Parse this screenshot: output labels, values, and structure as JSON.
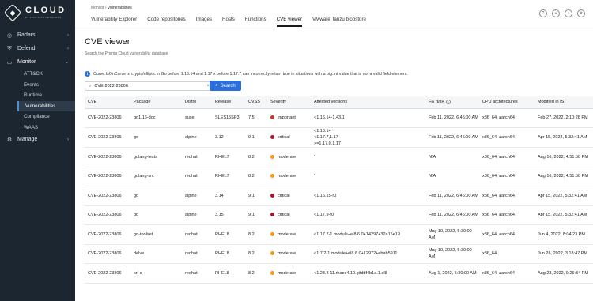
{
  "logo": {
    "title": "CLOUD",
    "subtitle": "BY PALO ALTO NETWORKS"
  },
  "sidebar": {
    "groups": [
      {
        "label": "Radars",
        "icon": "radar-icon"
      },
      {
        "label": "Defend",
        "icon": "shield-icon"
      },
      {
        "label": "Monitor",
        "icon": "monitor-icon"
      },
      {
        "label": "Manage",
        "icon": "gear-icon"
      }
    ],
    "monitor_items": [
      "ATT&CK",
      "Events",
      "Runtime",
      "Vulnerabilities",
      "Compliance",
      "WAAS"
    ]
  },
  "header": {
    "breadcrumb_parent": "Monitor",
    "breadcrumb_sep": " / ",
    "breadcrumb_current": "Vulnerabilities",
    "tabs": [
      "Vulnerability Explorer",
      "Code repositories",
      "Images",
      "Hosts",
      "Functions",
      "CVE viewer",
      "VMware Tanzu blobstore"
    ],
    "icons": [
      "help-icon",
      "user-icon",
      "bell-icon",
      "settings-icon"
    ]
  },
  "page": {
    "title": "CVE viewer",
    "subtitle": "Search the Prisma Cloud vulnerability database",
    "info_text": "Curve.IsOnCurve in crypto/elliptic in Go before 1.16.14 and 1.17.x before 1.17.7 can incorrectly return true in situations with a big.Int value that is not a valid field element.",
    "search_value": "CVE-2022-23806",
    "search_button": "Search"
  },
  "colors": {
    "critical": "#b3122e",
    "important": "#c0392b",
    "moderate": "#f39c12",
    "accent": "#2a6fdb",
    "sidebar": "#1c2631"
  },
  "table": {
    "columns": [
      "CVE",
      "Package",
      "Distro",
      "Release",
      "CVSS",
      "Severity",
      "Affected versions",
      "Fix date",
      "CPU architectures",
      "Modified in IS"
    ],
    "rows": [
      {
        "cve": "CVE-2022-23806",
        "package": "go1.16-doc",
        "distro": "suse",
        "release": "SLES15SP3",
        "cvss": "7.5",
        "severity": "important",
        "affected": "<1.16.14-1.43.1",
        "fix_date": "Feb 11, 2022, 6:45:00 AM",
        "cpu": "x86_64, aarch64",
        "modified": "Feb 27, 2022, 2:10:28 PM"
      },
      {
        "cve": "CVE-2022-23806",
        "package": "go",
        "distro": "alpine",
        "release": "3.12",
        "cvss": "9.1",
        "severity": "critical",
        "affected": "<1.16.14\n<1.17.7,1.17\n>=1.17.0,1.17",
        "fix_date": "Feb 11, 2022, 6:45:00 AM",
        "cpu": "x86_64, aarch64",
        "modified": "Apr 15, 2022, 5:32:41 AM"
      },
      {
        "cve": "CVE-2022-23806",
        "package": "golang-tests",
        "distro": "redhat",
        "release": "RHEL7",
        "cvss": "8.2",
        "severity": "moderate",
        "affected": "*",
        "fix_date": "N/A",
        "cpu": "x86_64, aarch64",
        "modified": "Aug 16, 2022, 4:51:58 PM"
      },
      {
        "cve": "CVE-2022-23806",
        "package": "golang-src",
        "distro": "redhat",
        "release": "RHEL7",
        "cvss": "8.2",
        "severity": "moderate",
        "affected": "*",
        "fix_date": "N/A",
        "cpu": "x86_64, aarch64",
        "modified": "Aug 16, 2022, 4:51:58 PM"
      },
      {
        "cve": "CVE-2022-23806",
        "package": "go",
        "distro": "alpine",
        "release": "3.14",
        "cvss": "9.1",
        "severity": "critical",
        "affected": "<1.16.15-r0",
        "fix_date": "Feb 11, 2022, 6:45:00 AM",
        "cpu": "x86_64, aarch64",
        "modified": "Apr 15, 2022, 5:32:41 AM"
      },
      {
        "cve": "CVE-2022-23806",
        "package": "go",
        "distro": "alpine",
        "release": "3.15",
        "cvss": "9.1",
        "severity": "critical",
        "affected": "<1.17.9-r0",
        "fix_date": "Feb 11, 2022, 6:45:00 AM",
        "cpu": "x86_64, aarch64",
        "modified": "Apr 15, 2022, 5:32:41 AM"
      },
      {
        "cve": "CVE-2022-23806",
        "package": "go-toolset",
        "distro": "redhat",
        "release": "RHEL8",
        "cvss": "8.2",
        "severity": "moderate",
        "affected": "<1.17.7-1.module+el8.6.0+14297+32a15e19",
        "fix_date": "May 10, 2022, 5:30:00 AM",
        "cpu": "x86_64, aarch64",
        "modified": "Jun 4, 2022, 8:04:23 PM"
      },
      {
        "cve": "CVE-2022-23806",
        "package": "delve",
        "distro": "redhat",
        "release": "RHEL8",
        "cvss": "8.2",
        "severity": "moderate",
        "affected": "<1.7.2-1.module+el8.6.0+12972+ebab5911",
        "fix_date": "May 10, 2022, 5:30:00 AM",
        "cpu": "x86_64",
        "modified": "Jun 26, 2022, 3:18:47 PM"
      },
      {
        "cve": "CVE-2022-23806",
        "package": "cri-o",
        "distro": "redhat",
        "release": "RHEL8",
        "cvss": "8.2",
        "severity": "moderate",
        "affected": "<1.23.3-11.rhaos4.10.gitddf4b1a.1.el8",
        "fix_date": "Aug 1, 2022, 5:30:00 AM",
        "cpu": "x86_64, aarch64",
        "modified": "Aug 23, 2022, 9:25:34 PM"
      }
    ]
  }
}
